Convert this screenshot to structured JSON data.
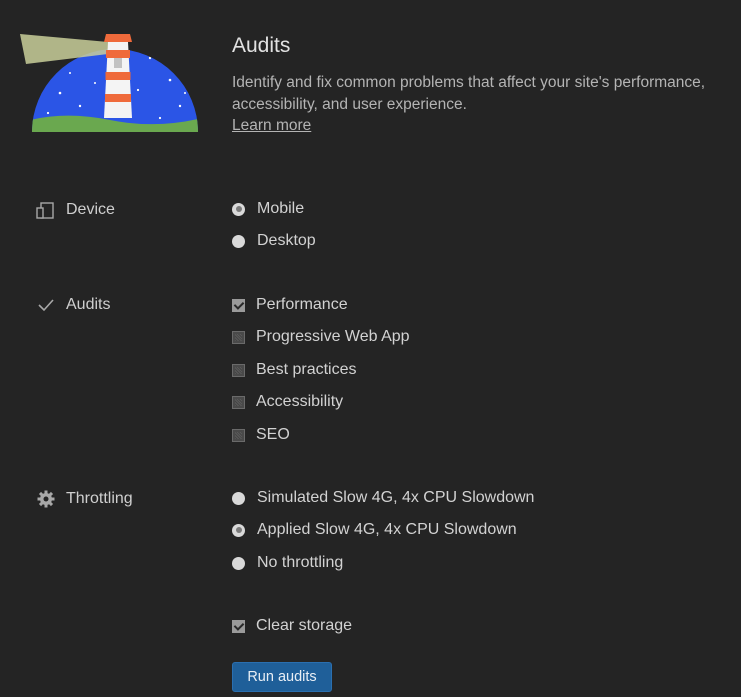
{
  "header": {
    "title": "Audits",
    "description_line1": "Identify and fix common problems that affect your site's performance,",
    "description_line2": "accessibility, and user experience.",
    "learn_more": "Learn more"
  },
  "device": {
    "label": "Device",
    "icon": "device-icon",
    "options": [
      {
        "label": "Mobile",
        "checked": true
      },
      {
        "label": "Desktop",
        "checked": false
      }
    ]
  },
  "audits": {
    "label": "Audits",
    "icon": "checkmark-icon",
    "options": [
      {
        "label": "Performance",
        "checked": true
      },
      {
        "label": "Progressive Web App",
        "checked": false
      },
      {
        "label": "Best practices",
        "checked": false
      },
      {
        "label": "Accessibility",
        "checked": false
      },
      {
        "label": "SEO",
        "checked": false
      }
    ]
  },
  "throttling": {
    "label": "Throttling",
    "icon": "gear-icon",
    "options": [
      {
        "label": "Simulated Slow 4G, 4x CPU Slowdown",
        "checked": false
      },
      {
        "label": "Applied Slow 4G, 4x CPU Slowdown",
        "checked": true
      },
      {
        "label": "No throttling",
        "checked": false
      }
    ]
  },
  "clear_storage": {
    "label": "Clear storage",
    "checked": true
  },
  "run_button": "Run audits",
  "colors": {
    "background": "#242424",
    "button": "#1f5f99",
    "logo_sky": "#2b55e6",
    "logo_grass": "#6aa84f"
  }
}
